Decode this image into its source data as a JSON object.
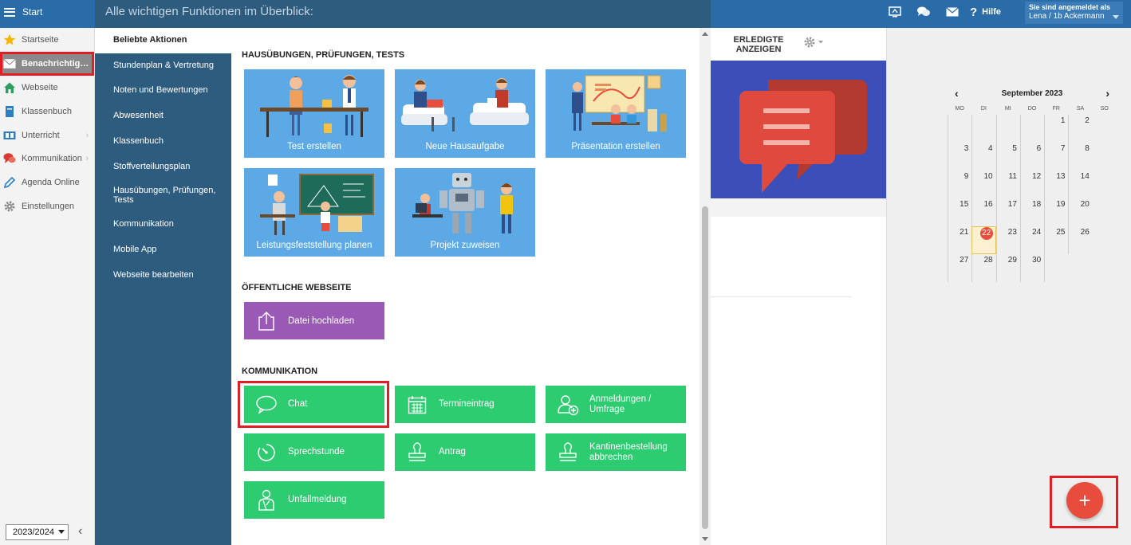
{
  "header": {
    "menu_label": "Start",
    "help_label": "Hilfe",
    "user": {
      "line1": "Sie sind angemeldet als",
      "line2": "Lena / 1b Ackermann"
    }
  },
  "sidebar": {
    "items": [
      {
        "label": "Startseite",
        "icon": "star-icon"
      },
      {
        "label": "Benachrichtig…",
        "icon": "envelope-icon",
        "active": true
      },
      {
        "label": "Webseite",
        "icon": "home-icon"
      },
      {
        "label": "Klassenbuch",
        "icon": "book-icon"
      },
      {
        "label": "Unterricht",
        "icon": "classroom-icon",
        "has_submenu": true
      },
      {
        "label": "Kommunikation",
        "icon": "chat-bubbles-icon",
        "has_submenu": true
      },
      {
        "label": "Agenda Online",
        "icon": "pencil-icon"
      },
      {
        "label": "Einstellungen",
        "icon": "gear-icon"
      }
    ],
    "school_year": "2023/2024"
  },
  "panel": {
    "title": "Alle wichtigen Funktionen im Überblick:",
    "categories": [
      {
        "label": "Beliebte Aktionen",
        "active": true
      },
      {
        "label": "Stundenplan & Vertretung"
      },
      {
        "label": "Noten und Bewertungen"
      },
      {
        "label": "Abwesenheit"
      },
      {
        "label": "Klassenbuch"
      },
      {
        "label": "Stoffverteilungsplan"
      },
      {
        "label": "Hausübungen, Prüfungen, Tests"
      },
      {
        "label": "Kommunikation"
      },
      {
        "label": "Mobile App"
      },
      {
        "label": "Webseite bearbeiten"
      }
    ],
    "sections": {
      "homework": {
        "heading": "HAUSÜBUNGEN, PRÜFUNGEN, TESTS",
        "tiles": [
          "Test erstellen",
          "Neue Hausaufgabe",
          "Präsentation erstellen",
          "Leistungsfeststellung planen",
          "Projekt zuweisen"
        ]
      },
      "website": {
        "heading": "ÖFFENTLICHE WEBSEITE",
        "tiles": [
          "Datei hochladen"
        ]
      },
      "communication": {
        "heading": "KOMMUNIKATION",
        "tiles": [
          "Chat",
          "Termineintrag",
          "Anmeldungen / Umfrage",
          "Sprechstunde",
          "Antrag",
          "Kantinenbestellung abbrechen",
          "Unfallmeldung"
        ]
      }
    }
  },
  "main": {
    "erledigte_label": "ERLEDIGTE ANZEIGEN"
  },
  "calendar": {
    "month_label": "September 2023",
    "weekdays": [
      "MO",
      "DI",
      "MI",
      "DO",
      "FR",
      "SA",
      "SO"
    ],
    "days": [
      "",
      "",
      "",
      "",
      "1",
      "2",
      "3",
      "4",
      "5",
      "6",
      "7",
      "8",
      "9",
      "10",
      "11",
      "12",
      "13",
      "14",
      "15",
      "16",
      "17",
      "18",
      "19",
      "20",
      "21",
      "22",
      "23",
      "24",
      "25",
      "26",
      "27",
      "28",
      "29",
      "30",
      ""
    ],
    "today": "22"
  },
  "fab": {
    "label": "+"
  },
  "colors": {
    "topbar": "#2a6ca8",
    "panel": "#2e5c7f",
    "tile_blue": "#5da9e5",
    "tile_green": "#2ecc71",
    "tile_purple": "#9b59b6",
    "highlight": "#e21d24",
    "fab": "#e74c3c"
  }
}
